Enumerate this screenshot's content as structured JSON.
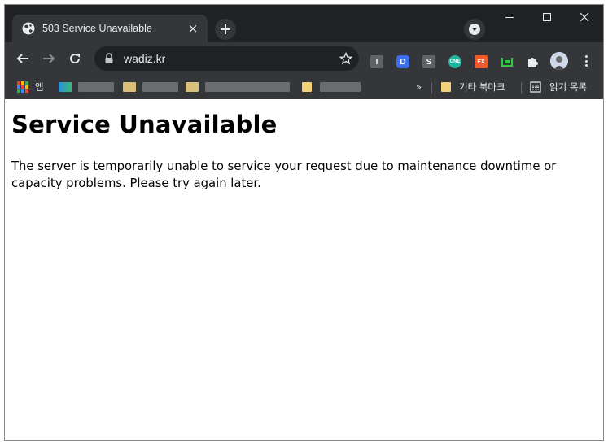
{
  "tab": {
    "title": "503 Service Unavailable",
    "close": "×"
  },
  "omnibox": {
    "url": "wadiz.kr"
  },
  "extensions": [
    {
      "name": "i-extension",
      "label": "I",
      "color": "#5f6368"
    },
    {
      "name": "d-extension",
      "label": "D",
      "color": "#3b6ff0"
    },
    {
      "name": "s-extension",
      "label": "S",
      "color": "#5f6368"
    },
    {
      "name": "one-extension",
      "label": "ONE",
      "color": "#1fb59f"
    },
    {
      "name": "ex-extension",
      "label": "EX",
      "color": "#f05a28"
    }
  ],
  "bookmarks": {
    "apps_label": "앱",
    "more": "»",
    "other_bookmarks": "기타 북마크",
    "reading_list": "읽기 목록"
  },
  "page": {
    "heading": "Service Unavailable",
    "message": "The server is temporarily unable to service your request due to maintenance downtime or capacity problems. Please try again later."
  }
}
